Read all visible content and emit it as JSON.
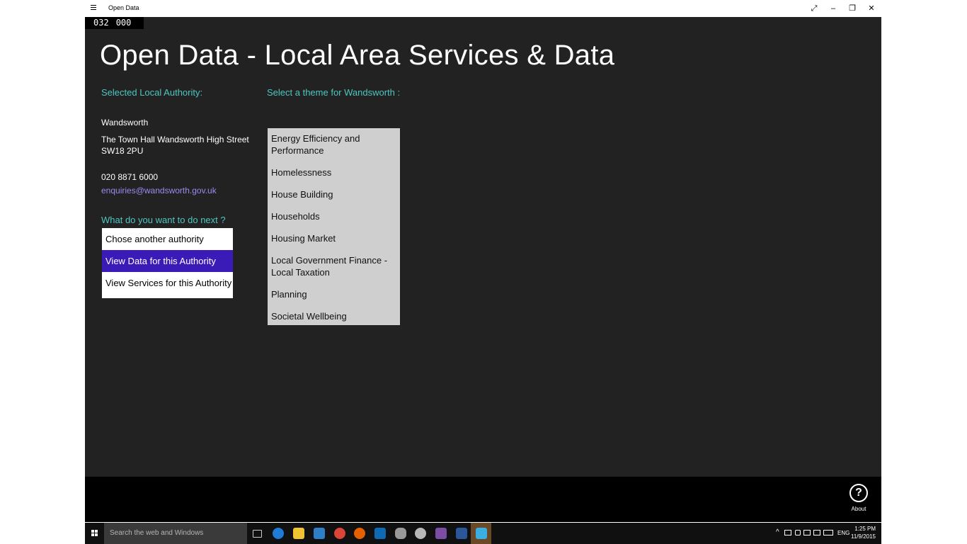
{
  "window": {
    "title": "Open Data",
    "controls": {
      "fullscreen": "⤢",
      "minimize": "–",
      "restore": "❐",
      "close": "✕"
    }
  },
  "counter": {
    "left": "032",
    "right": "000"
  },
  "page_title": "Open Data - Local Area Services & Data",
  "authority": {
    "label": "Selected Local Authority:",
    "name": "Wandsworth",
    "address_line1": "The Town Hall Wandsworth High Street",
    "address_line2": "SW18 2PU",
    "phone": "020 8871 6000",
    "email": "enquiries@wandsworth.gov.uk"
  },
  "next": {
    "label": "What do you want to do next ?",
    "actions": [
      {
        "label": "Chose another authority",
        "selected": false
      },
      {
        "label": "View Data for this Authority",
        "selected": true
      },
      {
        "label": "View Services for this Authority",
        "selected": false
      }
    ]
  },
  "themes": {
    "label": "Select a theme for Wandsworth :",
    "items": [
      "Energy Efficiency and Performance",
      "Homelessness",
      "House Building",
      "Households",
      "Housing Market",
      "Local Government Finance - Local Taxation",
      "Planning",
      "Societal Wellbeing"
    ]
  },
  "appbar": {
    "about_label": "About",
    "about_glyph": "?"
  },
  "taskbar": {
    "search_placeholder": "Search the web and Windows",
    "language": "ENG",
    "time": "1:25 PM",
    "date": "11/9/2015",
    "colors": {
      "accent": "#3b1bb8",
      "section_text": "#4ec6c0",
      "email": "#9a8cf0",
      "active_app": "#6a4a26"
    }
  }
}
